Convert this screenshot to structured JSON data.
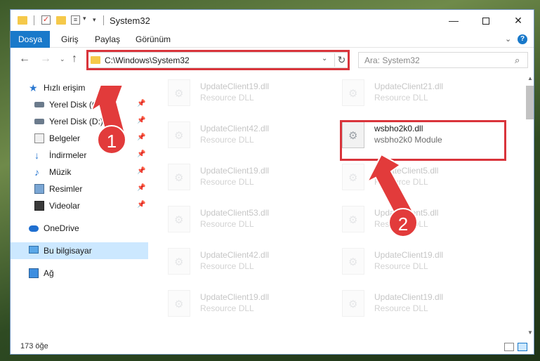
{
  "window": {
    "title": "System32",
    "qa_arrow": "▾",
    "controls": {
      "minimize": "—",
      "close": "✕"
    }
  },
  "ribbon": {
    "tabs": [
      "Dosya",
      "Giriş",
      "Paylaş",
      "Görünüm"
    ],
    "help": "?",
    "collapse": "⌄"
  },
  "navigation": {
    "back": "←",
    "forward": "→",
    "recent": "⌄",
    "up": "↑",
    "address": "C:\\Windows\\System32",
    "address_dropdown": "⌄",
    "refresh": "↻",
    "search_placeholder": "Ara: System32",
    "search_icon": "⌕"
  },
  "sidebar": {
    "items": [
      {
        "label": "Hızlı erişim",
        "icon": "star-icon",
        "pinned": false
      },
      {
        "label": "Yerel Disk (C:)",
        "icon": "drive-icon",
        "pinned": true
      },
      {
        "label": "Yerel Disk (D:)",
        "icon": "drive-icon",
        "pinned": true
      },
      {
        "label": "Belgeler",
        "icon": "document-icon",
        "pinned": true
      },
      {
        "label": "İndirmeler",
        "icon": "download-icon",
        "pinned": true
      },
      {
        "label": "Müzik",
        "icon": "music-icon",
        "pinned": true
      },
      {
        "label": "Resimler",
        "icon": "picture-icon",
        "pinned": true
      },
      {
        "label": "Videolar",
        "icon": "video-icon",
        "pinned": true
      },
      {
        "label": "OneDrive",
        "icon": "cloud-icon",
        "pinned": false
      },
      {
        "label": "Bu bilgisayar",
        "icon": "computer-icon",
        "pinned": false,
        "selected": true
      },
      {
        "label": "Ağ",
        "icon": "network-icon",
        "pinned": false
      }
    ],
    "pin_glyph": "📌"
  },
  "files": {
    "left_column": [
      {
        "name": "UpdateClient19.dll",
        "type": "Resource DLL"
      },
      {
        "name": "UpdateClient42.dll",
        "type": "Resource DLL"
      },
      {
        "name": "UpdateClient19.dll",
        "type": "Resource DLL"
      },
      {
        "name": "UpdateClient53.dll",
        "type": "Resource DLL"
      },
      {
        "name": "UpdateClient42.dll",
        "type": "Resource DLL"
      },
      {
        "name": "UpdateClient19.dll",
        "type": "Resource DLL"
      }
    ],
    "right_column": [
      {
        "name": "UpdateClient21.dll",
        "type": "Resource DLL"
      },
      {
        "name": "wsbho2k0.dll",
        "type": "wsbho2k0 Module",
        "highlighted": true
      },
      {
        "name": "UpdateClient5.dll",
        "type": "Resource DLL"
      },
      {
        "name": "UpdateClient5.dll",
        "type": "Resource DLL"
      },
      {
        "name": "UpdateClient19.dll",
        "type": "Resource DLL"
      },
      {
        "name": "UpdateClient19.dll",
        "type": "Resource DLL"
      }
    ]
  },
  "scrollbar": {
    "up": "▲",
    "down": "▼"
  },
  "status": {
    "item_count": "173 öğe"
  },
  "annotations": [
    {
      "number": "1"
    },
    {
      "number": "2"
    }
  ],
  "colors": {
    "accent": "#1979ca",
    "highlight": "#d9343b",
    "selection": "#cce8ff"
  }
}
